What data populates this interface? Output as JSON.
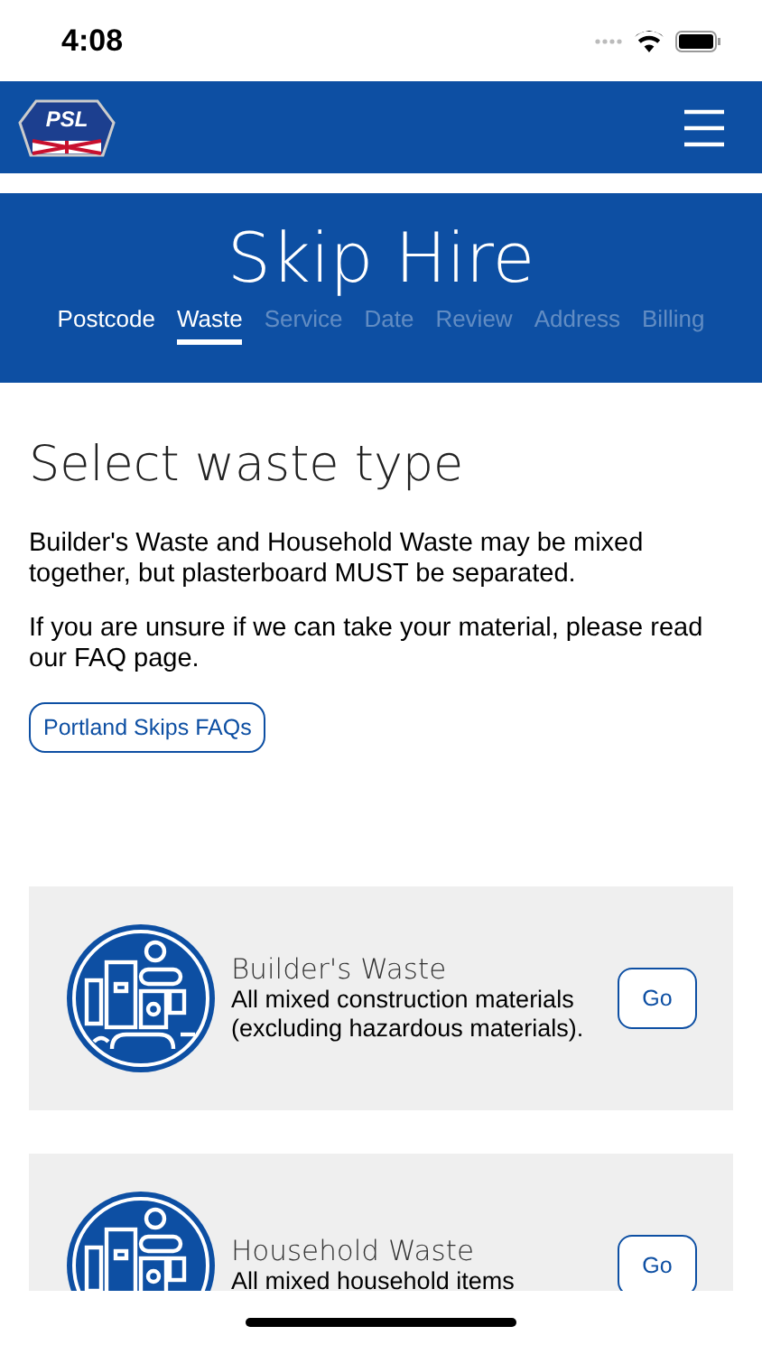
{
  "status_bar": {
    "time": "4:08"
  },
  "nav_bar": {
    "logo_text": "PSL"
  },
  "header": {
    "title": "Skip Hire",
    "steps": [
      {
        "label": "Postcode",
        "selected": false,
        "reached": true
      },
      {
        "label": "Waste",
        "selected": true,
        "reached": true
      },
      {
        "label": "Service",
        "selected": false,
        "reached": false
      },
      {
        "label": "Date",
        "selected": false,
        "reached": false
      },
      {
        "label": "Review",
        "selected": false,
        "reached": false
      },
      {
        "label": "Address",
        "selected": false,
        "reached": false
      },
      {
        "label": "Billing",
        "selected": false,
        "reached": false
      }
    ]
  },
  "content": {
    "heading": "Select waste type",
    "paragraphs": [
      "Builder's Waste and Household Waste may be mixed together, but plasterboard MUST be separated.",
      "If you are unsure if we can take your material, please read our FAQ page."
    ],
    "faq_button": "Portland Skips FAQs",
    "waste_types": [
      {
        "name": "Builder's Waste",
        "description": "All mixed construction materials (excluding hazardous materials).",
        "button": "Go"
      },
      {
        "name": "Household Waste",
        "description": "All mixed household items",
        "button": "Go"
      }
    ]
  }
}
